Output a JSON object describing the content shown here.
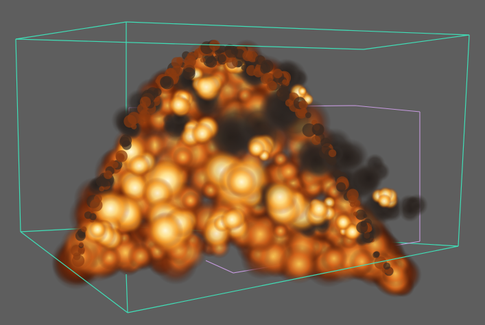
{
  "viewport": {
    "background": "#5e5e5e",
    "subject": "explosion-fireball-volume"
  },
  "colors": {
    "outer_container": "#3fe0b8",
    "inner_bounds": "#c79be0",
    "fire_core": "#fff6c6",
    "fire_mid": "#ffc54a",
    "fire_edge": "#b8420a",
    "smoke": "#2a2420"
  },
  "icons": {
    "outer_box": "container-bounding-box-icon",
    "inner_box": "density-bounds-box-icon"
  }
}
